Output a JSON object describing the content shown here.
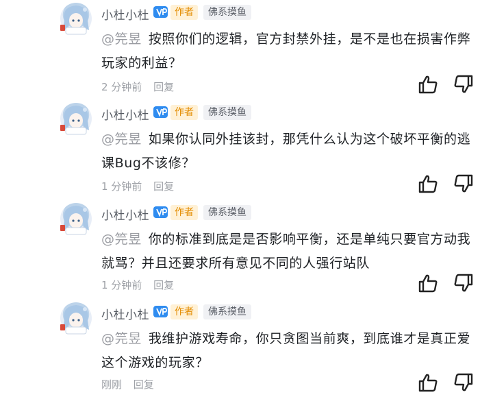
{
  "comments": [
    {
      "author": "小杜小杜",
      "author_tag": "作者",
      "group_tag": "佛系摸鱼",
      "mention": "@笎昱",
      "text": "按照你们的逻辑，官方封禁外挂，是不是也在损害作弊玩家的利益？",
      "time": "2 分钟前",
      "reply": "回复"
    },
    {
      "author": "小杜小杜",
      "author_tag": "作者",
      "group_tag": "佛系摸鱼",
      "mention": "@笎昱",
      "text": "如果你认同外挂该封，那凭什么认为这个破坏平衡的逃课Bug不该修？",
      "time": "1 分钟前",
      "reply": "回复"
    },
    {
      "author": "小杜小杜",
      "author_tag": "作者",
      "group_tag": "佛系摸鱼",
      "mention": "@笎昱",
      "text": "你的标准到底是是否影响平衡，还是单纯只要官方动我就骂？并且还要求所有意见不同的人强行站队",
      "time": "1 分钟前",
      "reply": "回复"
    },
    {
      "author": "小杜小杜",
      "author_tag": "作者",
      "group_tag": "佛系摸鱼",
      "mention": "@笎昱",
      "text": "我维护游戏寿命，你只贪图当前爽，到底谁才是真正爱这个游戏的玩家？",
      "time": "刚刚",
      "reply": "回复"
    }
  ],
  "icons": {
    "vip_badge": "vip-badge-icon",
    "like": "thumbs-up-icon",
    "dislike": "thumbs-down-icon"
  },
  "colors": {
    "vip_blue": "#2f8cf0",
    "author_tag_text": "#e38c00",
    "author_tag_bg": "#fff1d6"
  }
}
